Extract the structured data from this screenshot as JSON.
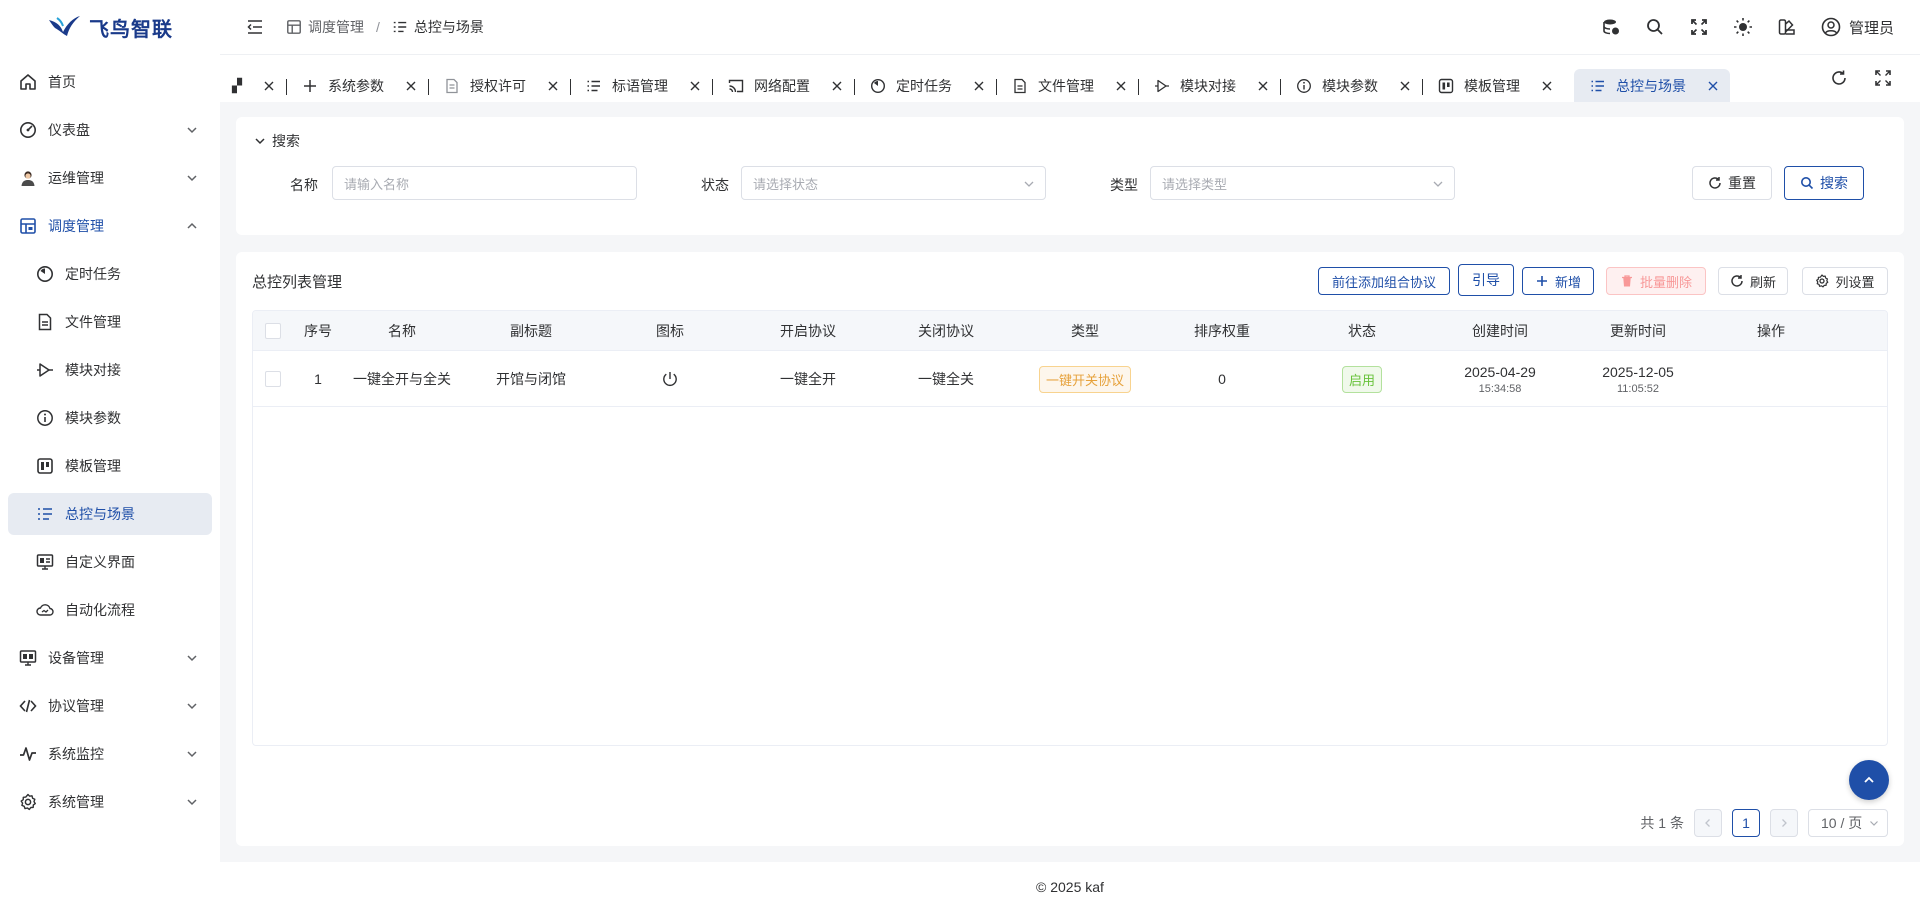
{
  "app": {
    "brand": "飞鸟智联"
  },
  "sidebar": {
    "items": [
      {
        "label": "首页",
        "icon": "home-icon"
      },
      {
        "label": "仪表盘",
        "icon": "dashboard-icon"
      },
      {
        "label": "运维管理",
        "icon": "operator-avatar-icon"
      },
      {
        "label": "调度管理",
        "icon": "schedule-icon"
      },
      {
        "label": "定时任务",
        "icon": "clock-icon"
      },
      {
        "label": "文件管理",
        "icon": "file-icon"
      },
      {
        "label": "模块对接",
        "icon": "module-connect-icon"
      },
      {
        "label": "模块参数",
        "icon": "info-icon"
      },
      {
        "label": "模板管理",
        "icon": "template-icon"
      },
      {
        "label": "总控与场景",
        "icon": "list-icon"
      },
      {
        "label": "自定义界面",
        "icon": "monitor-icon"
      },
      {
        "label": "自动化流程",
        "icon": "cloud-flow-icon"
      },
      {
        "label": "设备管理",
        "icon": "device-icon"
      },
      {
        "label": "协议管理",
        "icon": "code-icon"
      },
      {
        "label": "系统监控",
        "icon": "pulse-icon"
      },
      {
        "label": "系统管理",
        "icon": "gear-icon"
      }
    ]
  },
  "header": {
    "breadcrumb": [
      "调度管理",
      "/",
      "总控与场景"
    ],
    "user": "管理员"
  },
  "tabs": [
    {
      "label": "系统参数",
      "icon": "plus-icon"
    },
    {
      "label": "授权许可",
      "icon": "license-icon"
    },
    {
      "label": "标语管理",
      "icon": "list-icon"
    },
    {
      "label": "网络配置",
      "icon": "cast-icon"
    },
    {
      "label": "定时任务",
      "icon": "clock-icon"
    },
    {
      "label": "文件管理",
      "icon": "file-icon"
    },
    {
      "label": "模块对接",
      "icon": "module-connect-icon"
    },
    {
      "label": "模块参数",
      "icon": "info-icon"
    },
    {
      "label": "模板管理",
      "icon": "template-icon"
    },
    {
      "label": "总控与场景",
      "icon": "list-icon",
      "active": true
    }
  ],
  "search": {
    "title": "搜索",
    "name_label": "名称",
    "name_placeholder": "请输入名称",
    "status_label": "状态",
    "status_placeholder": "请选择状态",
    "type_label": "类型",
    "type_placeholder": "请选择类型",
    "reset": "重置",
    "submit": "搜索"
  },
  "table": {
    "title": "总控列表管理",
    "toolbar": {
      "goto_combo": "前往添加组合协议",
      "guide": "引导",
      "add": "新增",
      "batch_delete": "批量删除",
      "refresh": "刷新",
      "columns": "列设置"
    },
    "columns": [
      "序号",
      "名称",
      "副标题",
      "图标",
      "开启协议",
      "关闭协议",
      "类型",
      "排序权重",
      "状态",
      "创建时间",
      "更新时间",
      "操作"
    ],
    "rows": [
      {
        "index": "1",
        "name": "一键全开与全关",
        "subtitle": "开馆与闭馆",
        "icon": "power-icon",
        "open_protocol": "一键全开",
        "close_protocol": "一键全关",
        "type": "一键开关协议",
        "weight": "0",
        "status": "启用",
        "created_date": "2025-04-29",
        "created_time": "15:34:58",
        "updated_date": "2025-12-05",
        "updated_time": "11:05:52"
      }
    ]
  },
  "pagination": {
    "total": "共 1 条",
    "current": "1",
    "page_size": "10 / 页"
  },
  "footer": "© 2025 kaf",
  "colors": {
    "primary": "#1f4fa8",
    "warning": "#e6a23c",
    "success": "#67c23a",
    "danger": "#f89898"
  }
}
